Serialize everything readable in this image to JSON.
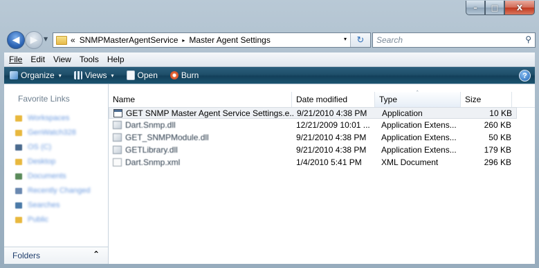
{
  "window": {
    "controls": {
      "minimize": "–",
      "maximize": "□",
      "close": "X"
    }
  },
  "address_bar": {
    "overflow": "«",
    "segments": [
      "SNMPMasterAgentService",
      "Master Agent Settings"
    ],
    "separator": "▸",
    "dropdown": "▾",
    "refresh": "↻"
  },
  "search": {
    "placeholder": "Search",
    "icon": "search-icon"
  },
  "menu": {
    "items": [
      {
        "label": "File"
      },
      {
        "label": "Edit"
      },
      {
        "label": "View"
      },
      {
        "label": "Tools"
      },
      {
        "label": "Help"
      }
    ]
  },
  "toolbar": {
    "organize": "Organize",
    "views": "Views",
    "open": "Open",
    "burn": "Burn",
    "dropdown_arrow": "▾",
    "help": "?"
  },
  "nav_pane": {
    "heading": "Favorite Links",
    "links": [
      {
        "label": "Workspaces",
        "color": "#e8b83e"
      },
      {
        "label": "GenWatch328",
        "color": "#e8b83e"
      },
      {
        "label": "OS (C)",
        "color": "#4b6b8e"
      },
      {
        "label": "Desktop",
        "color": "#e8b83e"
      },
      {
        "label": "Documents",
        "color": "#5a8a5a"
      },
      {
        "label": "Recently Changed",
        "color": "#6a88b0"
      },
      {
        "label": "Searches",
        "color": "#4b7aa8"
      },
      {
        "label": "Public",
        "color": "#e8b83e"
      }
    ],
    "folders_label": "Folders",
    "folders_chevron": "⌃"
  },
  "file_list": {
    "columns": {
      "name": "Name",
      "date": "Date modified",
      "type": "Type",
      "size": "Size"
    },
    "sort_indicator": "ˆ",
    "rows": [
      {
        "name": "GET SNMP Master Agent Service Settings.e...",
        "date": "9/21/2010 4:38 PM",
        "type": "Application",
        "size": "10 KB",
        "icon": "app"
      },
      {
        "name": "Dart.Snmp.dll",
        "date": "12/21/2009 10:01 ...",
        "type": "Application Extens...",
        "size": "260 KB",
        "icon": "dll"
      },
      {
        "name": "GET_SNMPModule.dll",
        "date": "9/21/2010 4:38 PM",
        "type": "Application Extens...",
        "size": "50 KB",
        "icon": "dll"
      },
      {
        "name": "GETLibrary.dll",
        "date": "9/21/2010 4:38 PM",
        "type": "Application Extens...",
        "size": "179 KB",
        "icon": "dll"
      },
      {
        "name": "Dart.Snmp.xml",
        "date": "1/4/2010 5:41 PM",
        "type": "XML Document",
        "size": "296 KB",
        "icon": "xml"
      }
    ]
  }
}
